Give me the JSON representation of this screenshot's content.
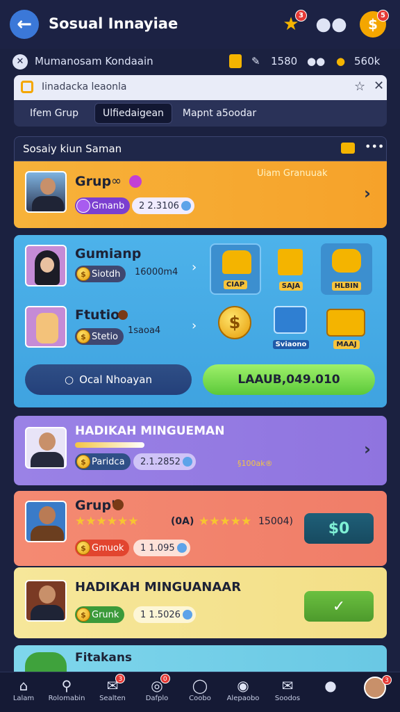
{
  "header": {
    "title": "Sosual Innayiae",
    "back_icon": "arrow-left-icon",
    "star_badge": "3",
    "profile_badge": "5"
  },
  "status": {
    "label": "Mumanosam Kondaain",
    "value_a": "1580",
    "value_b": "560k"
  },
  "search": {
    "text": "Iinadacka leaonla"
  },
  "tabs": [
    {
      "label": "Ifem Grup"
    },
    {
      "label": "Ulfiedaigean"
    },
    {
      "label": "Mapnt a5oodar"
    }
  ],
  "section": {
    "title": "Sosaiy kiun Saman"
  },
  "cards": {
    "grup": {
      "name": "Grup",
      "promo": "Uiam Granuuak",
      "tag": "Gmanb",
      "value": "2 2.3106"
    },
    "shop": {
      "row1_name": "Gumianp",
      "row1_tag": "Siotdh",
      "row1_value": "16000m4",
      "row2_name": "Ftutio",
      "row2_tag": "Stetio",
      "row2_value": "1saoa4",
      "items": [
        "CIAP",
        "SAJA",
        "HLBIN",
        "",
        "Sviaono",
        "MAAJ"
      ],
      "btn_left": "Ocal Nhoayan",
      "btn_right": "LAAUB,049.010"
    },
    "hadiah1": {
      "name": "HADIKAH MINGUEMAN",
      "tag": "Paridca",
      "value": "2.1.2852",
      "small": "§100ak®"
    },
    "grup2": {
      "name": "Grup'",
      "stars_text": "(0A)",
      "stars_value": "15004)",
      "tag": "Gmuok",
      "value": "1 1.095",
      "action": "$0"
    },
    "hadiah2": {
      "name": "HADIKAH MINGUANAAR",
      "tag": "Grunk",
      "value": "1 1.5026",
      "action": "✓"
    },
    "fit": {
      "name": "Fitakans"
    }
  },
  "nav": [
    {
      "label": "Lalam",
      "icon": "home-icon"
    },
    {
      "label": "Rolomabin",
      "icon": "search-icon"
    },
    {
      "label": "Sealten",
      "icon": "mail-icon",
      "badge": "3"
    },
    {
      "label": "Dafplo",
      "icon": "target-icon",
      "badge": "0"
    },
    {
      "label": "Coobo",
      "icon": "circle-icon"
    },
    {
      "label": "Alepaobo",
      "icon": "chat-icon"
    },
    {
      "label": "Soodos",
      "icon": "message-icon"
    },
    {
      "label": "",
      "icon": "person-icon"
    },
    {
      "label": "",
      "icon": "avatar-icon",
      "badge": "3"
    }
  ]
}
